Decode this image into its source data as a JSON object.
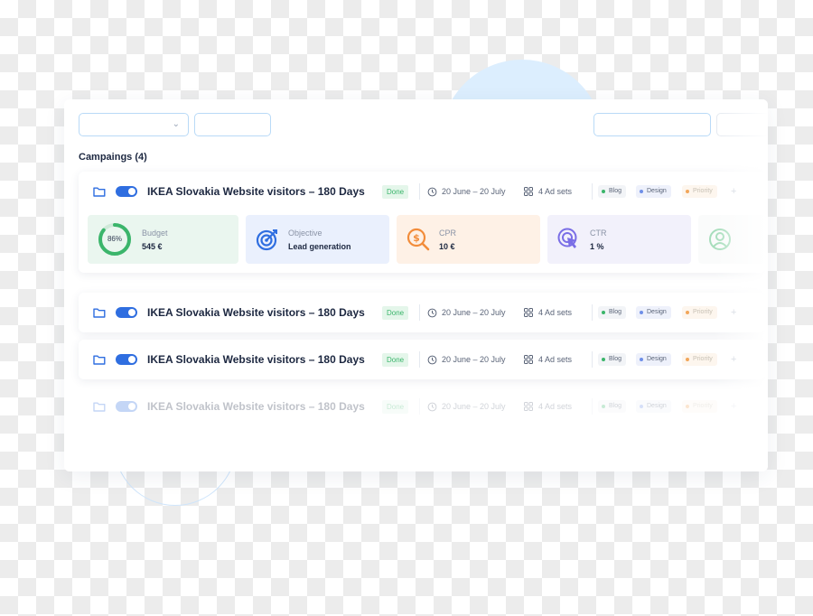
{
  "section_title": "Campaings (4)",
  "campaigns": [
    {
      "title": "IKEA Slovakia Website visitors  – 180 Days",
      "status": "Done",
      "dates": "20 June – 20 July",
      "ad_sets": "4 Ad sets",
      "tags": [
        "Blog",
        "Design",
        "Priority"
      ],
      "enabled": true,
      "metrics": {
        "budget": {
          "label": "Budget",
          "value": "545 €",
          "percent": 86,
          "percent_text": "86%"
        },
        "objective": {
          "label": "Objective",
          "value": "Lead generation"
        },
        "cpr": {
          "label": "CPR",
          "value": "10 €"
        },
        "ctr": {
          "label": "CTR",
          "value": "1 %"
        }
      }
    },
    {
      "title": "IKEA Slovakia Website visitors  – 180 Days",
      "status": "Done",
      "dates": "20 June – 20 July",
      "ad_sets": "4 Ad sets",
      "tags": [
        "Blog",
        "Design",
        "Priority"
      ],
      "enabled": true
    },
    {
      "title": "IKEA Slovakia Website visitors  – 180 Days",
      "status": "Done",
      "dates": "20 June – 20 July",
      "ad_sets": "4 Ad sets",
      "tags": [
        "Blog",
        "Design",
        "Priority"
      ],
      "enabled": true
    },
    {
      "title": "IKEA Slovakia Website visitors  – 180 Days",
      "status": "Done",
      "dates": "20 June – 20 July",
      "ad_sets": "4 Ad sets",
      "tags": [
        "Blog",
        "Design",
        "Priority"
      ],
      "enabled": true
    }
  ],
  "colors": {
    "accent": "#2f6ee0",
    "done": "#3bb56b",
    "tag_blog": "#3bb56b",
    "tag_design": "#6f8fe8",
    "tag_priority": "#f2a65a",
    "budget": "#3bb56b",
    "objective": "#2f6ee0",
    "cpr": "#f28c3a",
    "ctr": "#7a6ee6"
  },
  "icons": {
    "folder": "folder-icon",
    "toggle": "toggle-switch",
    "clock": "clock-icon",
    "ad_sets": "grid-icon",
    "objective": "target-icon",
    "cpr": "dollar-search-icon",
    "ctr": "cursor-click-icon",
    "extra": "person-icon"
  }
}
